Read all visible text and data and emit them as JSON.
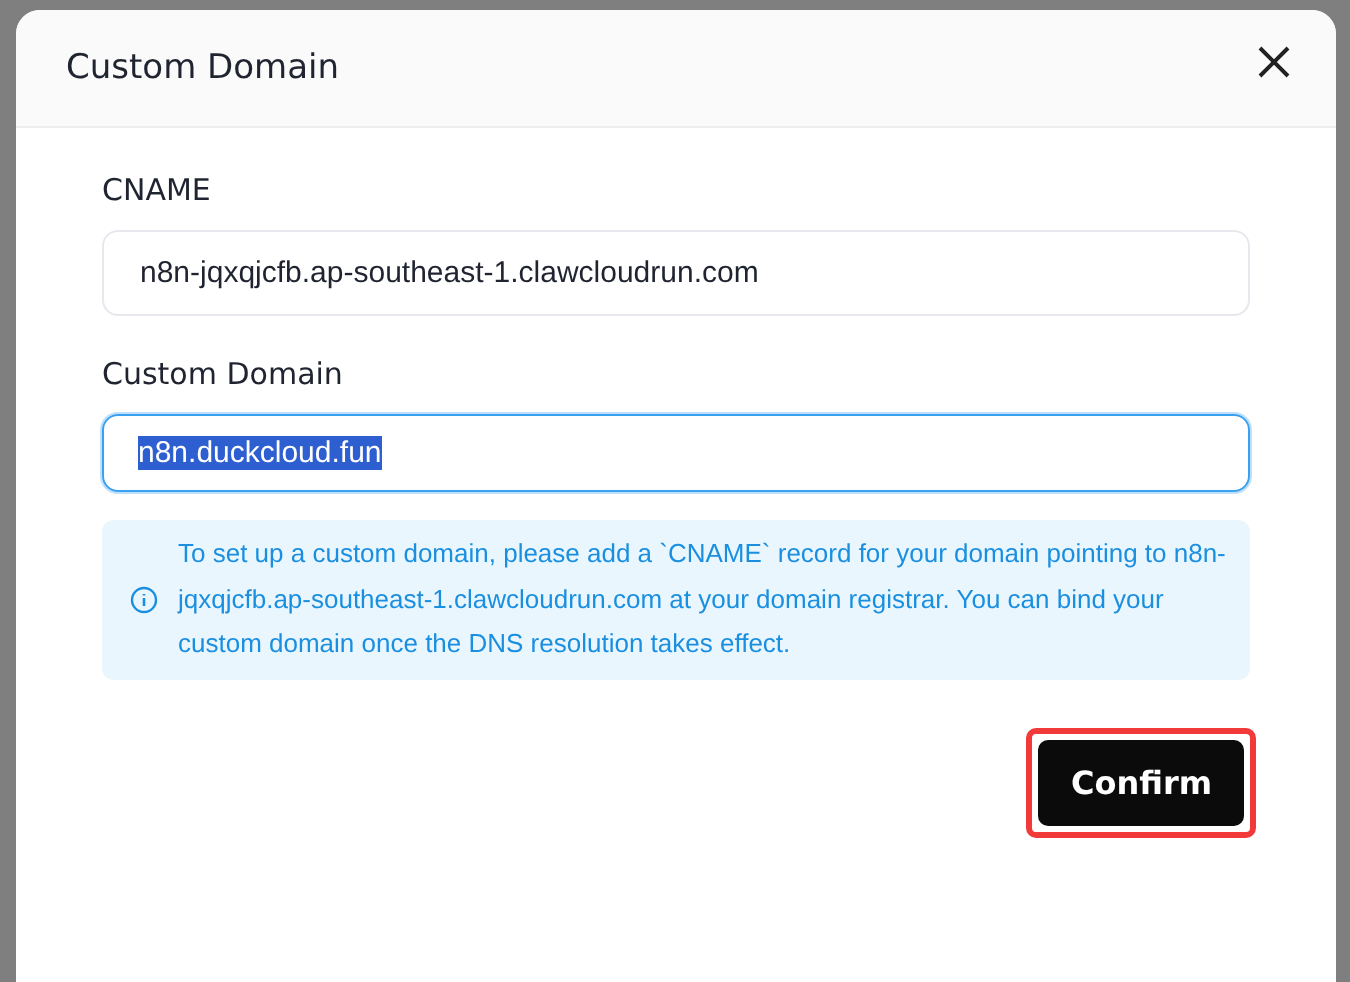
{
  "dialog": {
    "title": "Custom Domain",
    "fields": [
      {
        "label": "CNAME",
        "value": "n8n-jqxqjcfb.ap-southeast-1.clawcloudrun.com",
        "focused": false,
        "text_selected": false
      },
      {
        "label": "Custom Domain",
        "value": "n8n.duckcloud.fun",
        "focused": true,
        "text_selected": true
      }
    ],
    "info": "To set up a custom domain, please add a `CNAME` record for your domain pointing to n8n-jqxqjcfb.ap-southeast-1.clawcloudrun.com at your domain registrar. You can bind your custom domain once the DNS resolution takes effect.",
    "confirm_button": {
      "label": "Confirm",
      "highlighted": true
    }
  }
}
